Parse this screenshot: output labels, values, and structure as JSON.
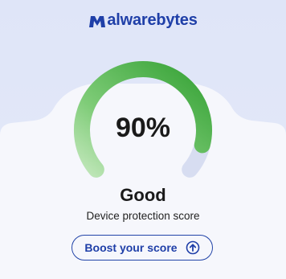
{
  "brand": {
    "name_bold": "alwarebytes",
    "name_thin": "",
    "logo_icon": "malwarebytes-m-icon",
    "color": "#1f3fa8"
  },
  "gauge": {
    "score_text": "90%",
    "score_fraction": 0.9,
    "track_color": "#d6dcf0",
    "fill_color_start": "#b7e3b0",
    "fill_color_end": "#3aa43a"
  },
  "status": {
    "label": "Good",
    "caption": "Device protection score"
  },
  "boost_button": {
    "label": "Boost your score",
    "icon": "arrow-up-circle-icon"
  }
}
